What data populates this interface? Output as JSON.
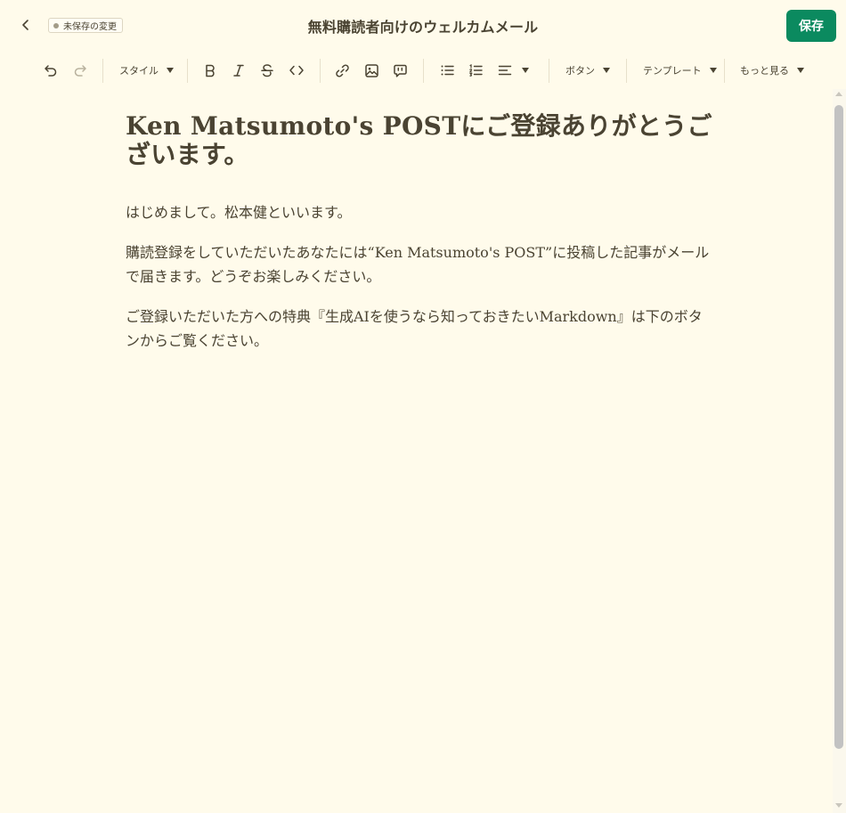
{
  "header": {
    "unsaved_label": "未保存の変更",
    "title": "無料購読者向けのウェルカムメール",
    "save_label": "保存"
  },
  "toolbar": {
    "style_label": "スタイル",
    "button_label": "ボタン",
    "template_label": "テンプレート",
    "more_label": "もっと見る"
  },
  "editor": {
    "title": "Ken Matsumoto's POSTにご登録ありがとうございます。",
    "paragraphs": [
      "はじめまして。松本健といいます。",
      "購読登録をしていただいたあなたには“Ken Matsumoto's POST”に投稿した記事がメールで届きます。どうぞお楽しみください。",
      "ご登録いただいた方への特典『生成AIを使うなら知っておきたいMarkdown』は下のボタンからご覧ください。"
    ]
  },
  "colors": {
    "background": "#fffbeb",
    "text": "#4a4332",
    "accent": "#0b8a5f"
  },
  "icons": {
    "back": "chevron-left-icon",
    "undo": "undo-icon",
    "redo": "redo-icon",
    "bold": "bold-icon",
    "italic": "italic-icon",
    "strikethrough": "strikethrough-icon",
    "code": "code-icon",
    "link": "link-icon",
    "image": "image-icon",
    "quote": "quote-icon",
    "bullet_list": "bullet-list-icon",
    "ordered_list": "ordered-list-icon",
    "align": "align-left-icon"
  }
}
